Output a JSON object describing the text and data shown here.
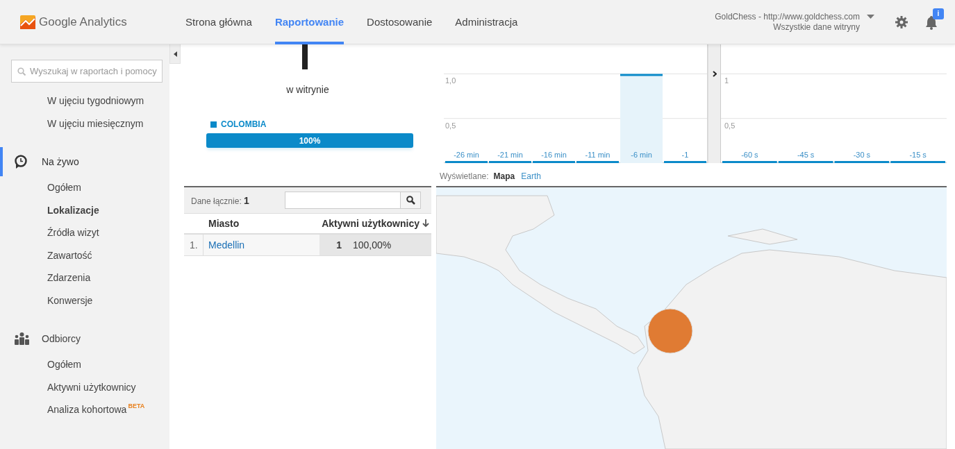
{
  "header": {
    "logo_text": "Google Analytics",
    "tabs": [
      {
        "label": "Strona główna",
        "selected": false
      },
      {
        "label": "Raportowanie",
        "selected": true
      },
      {
        "label": "Dostosowanie",
        "selected": false
      },
      {
        "label": "Administracja",
        "selected": false
      }
    ],
    "account": {
      "name": "GoldChess - http://www.goldchess.com",
      "view": "Wszystkie dane witryny"
    },
    "notification_badge": "i"
  },
  "sidebar": {
    "search": {
      "placeholder": "Wyszukaj w raportach i pomocy"
    },
    "sections": [
      {
        "kind": "plain",
        "items": [
          {
            "label": "W ujęciu tygodniowym",
            "selected": false
          },
          {
            "label": "W ujęciu miesięcznym",
            "selected": false
          }
        ]
      },
      {
        "kind": "realtime",
        "label": "Na żywo",
        "active": true,
        "items": [
          {
            "label": "Ogółem",
            "selected": false
          },
          {
            "label": "Lokalizacje",
            "selected": true
          },
          {
            "label": "Źródła wizyt",
            "selected": false
          },
          {
            "label": "Zawartość",
            "selected": false
          },
          {
            "label": "Zdarzenia",
            "selected": false
          },
          {
            "label": "Konwersje",
            "selected": false
          }
        ]
      },
      {
        "kind": "audience",
        "label": "Odbiorcy",
        "active": false,
        "items": [
          {
            "label": "Ogółem",
            "selected": false
          },
          {
            "label": "Aktywni użytkownicy",
            "selected": false
          },
          {
            "label": "Analiza kohortowa",
            "badge": "BETA",
            "selected": false
          }
        ]
      }
    ]
  },
  "summary": {
    "caption": "w witrynie",
    "country": {
      "name": "COLOMBIA",
      "color": "#0b8ac9",
      "level": 1,
      "reading": "100%"
    }
  },
  "table": {
    "total_label": "Dane łącznie:",
    "total": "1",
    "columns": [
      "Miasto",
      "Aktywni użytkownicy"
    ],
    "rows": [
      {
        "index": "1.",
        "city": "Medellin",
        "users": "1",
        "share": "100,00%"
      }
    ]
  },
  "minutes_chart": {
    "chart_data": {
      "type": "bar",
      "categories": [
        "-26 min",
        "-21 min",
        "-16 min",
        "-11 min",
        "-6 min",
        "-1"
      ],
      "values": [
        0,
        0,
        0,
        0,
        1,
        0
      ],
      "ylim": [
        0,
        1.33
      ],
      "yticks": [
        {
          "value": 0.5,
          "label": "0,5"
        },
        {
          "value": 1,
          "label": "1,0"
        }
      ]
    }
  },
  "seconds_chart": {
    "chart_data": {
      "type": "bar",
      "categories": [
        "-60 s",
        "-45 s",
        "-30 s",
        "-15 s"
      ],
      "values": [
        0,
        0,
        0,
        0
      ],
      "ylim": [
        0,
        1.33
      ],
      "yticks": [
        {
          "value": 0.5,
          "label": "0,5"
        },
        {
          "value": 1,
          "label": "1"
        }
      ]
    }
  },
  "view_toggle": {
    "label": "Wyświetlane:",
    "options": [
      {
        "label": "Mapa",
        "selected": true
      },
      {
        "label": "Earth",
        "selected": false
      }
    ]
  },
  "map": {
    "markers": [
      {
        "color": "#e07b33"
      }
    ]
  }
}
